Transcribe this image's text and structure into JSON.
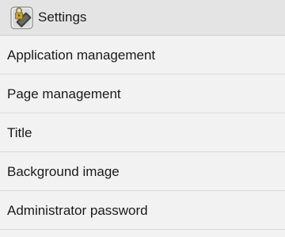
{
  "header": {
    "icon": "settings-lock-icon",
    "title": "Settings"
  },
  "menu": {
    "items": [
      {
        "label": "Application management"
      },
      {
        "label": "Page management"
      },
      {
        "label": "Title"
      },
      {
        "label": "Background image"
      },
      {
        "label": "Administrator password"
      }
    ]
  }
}
